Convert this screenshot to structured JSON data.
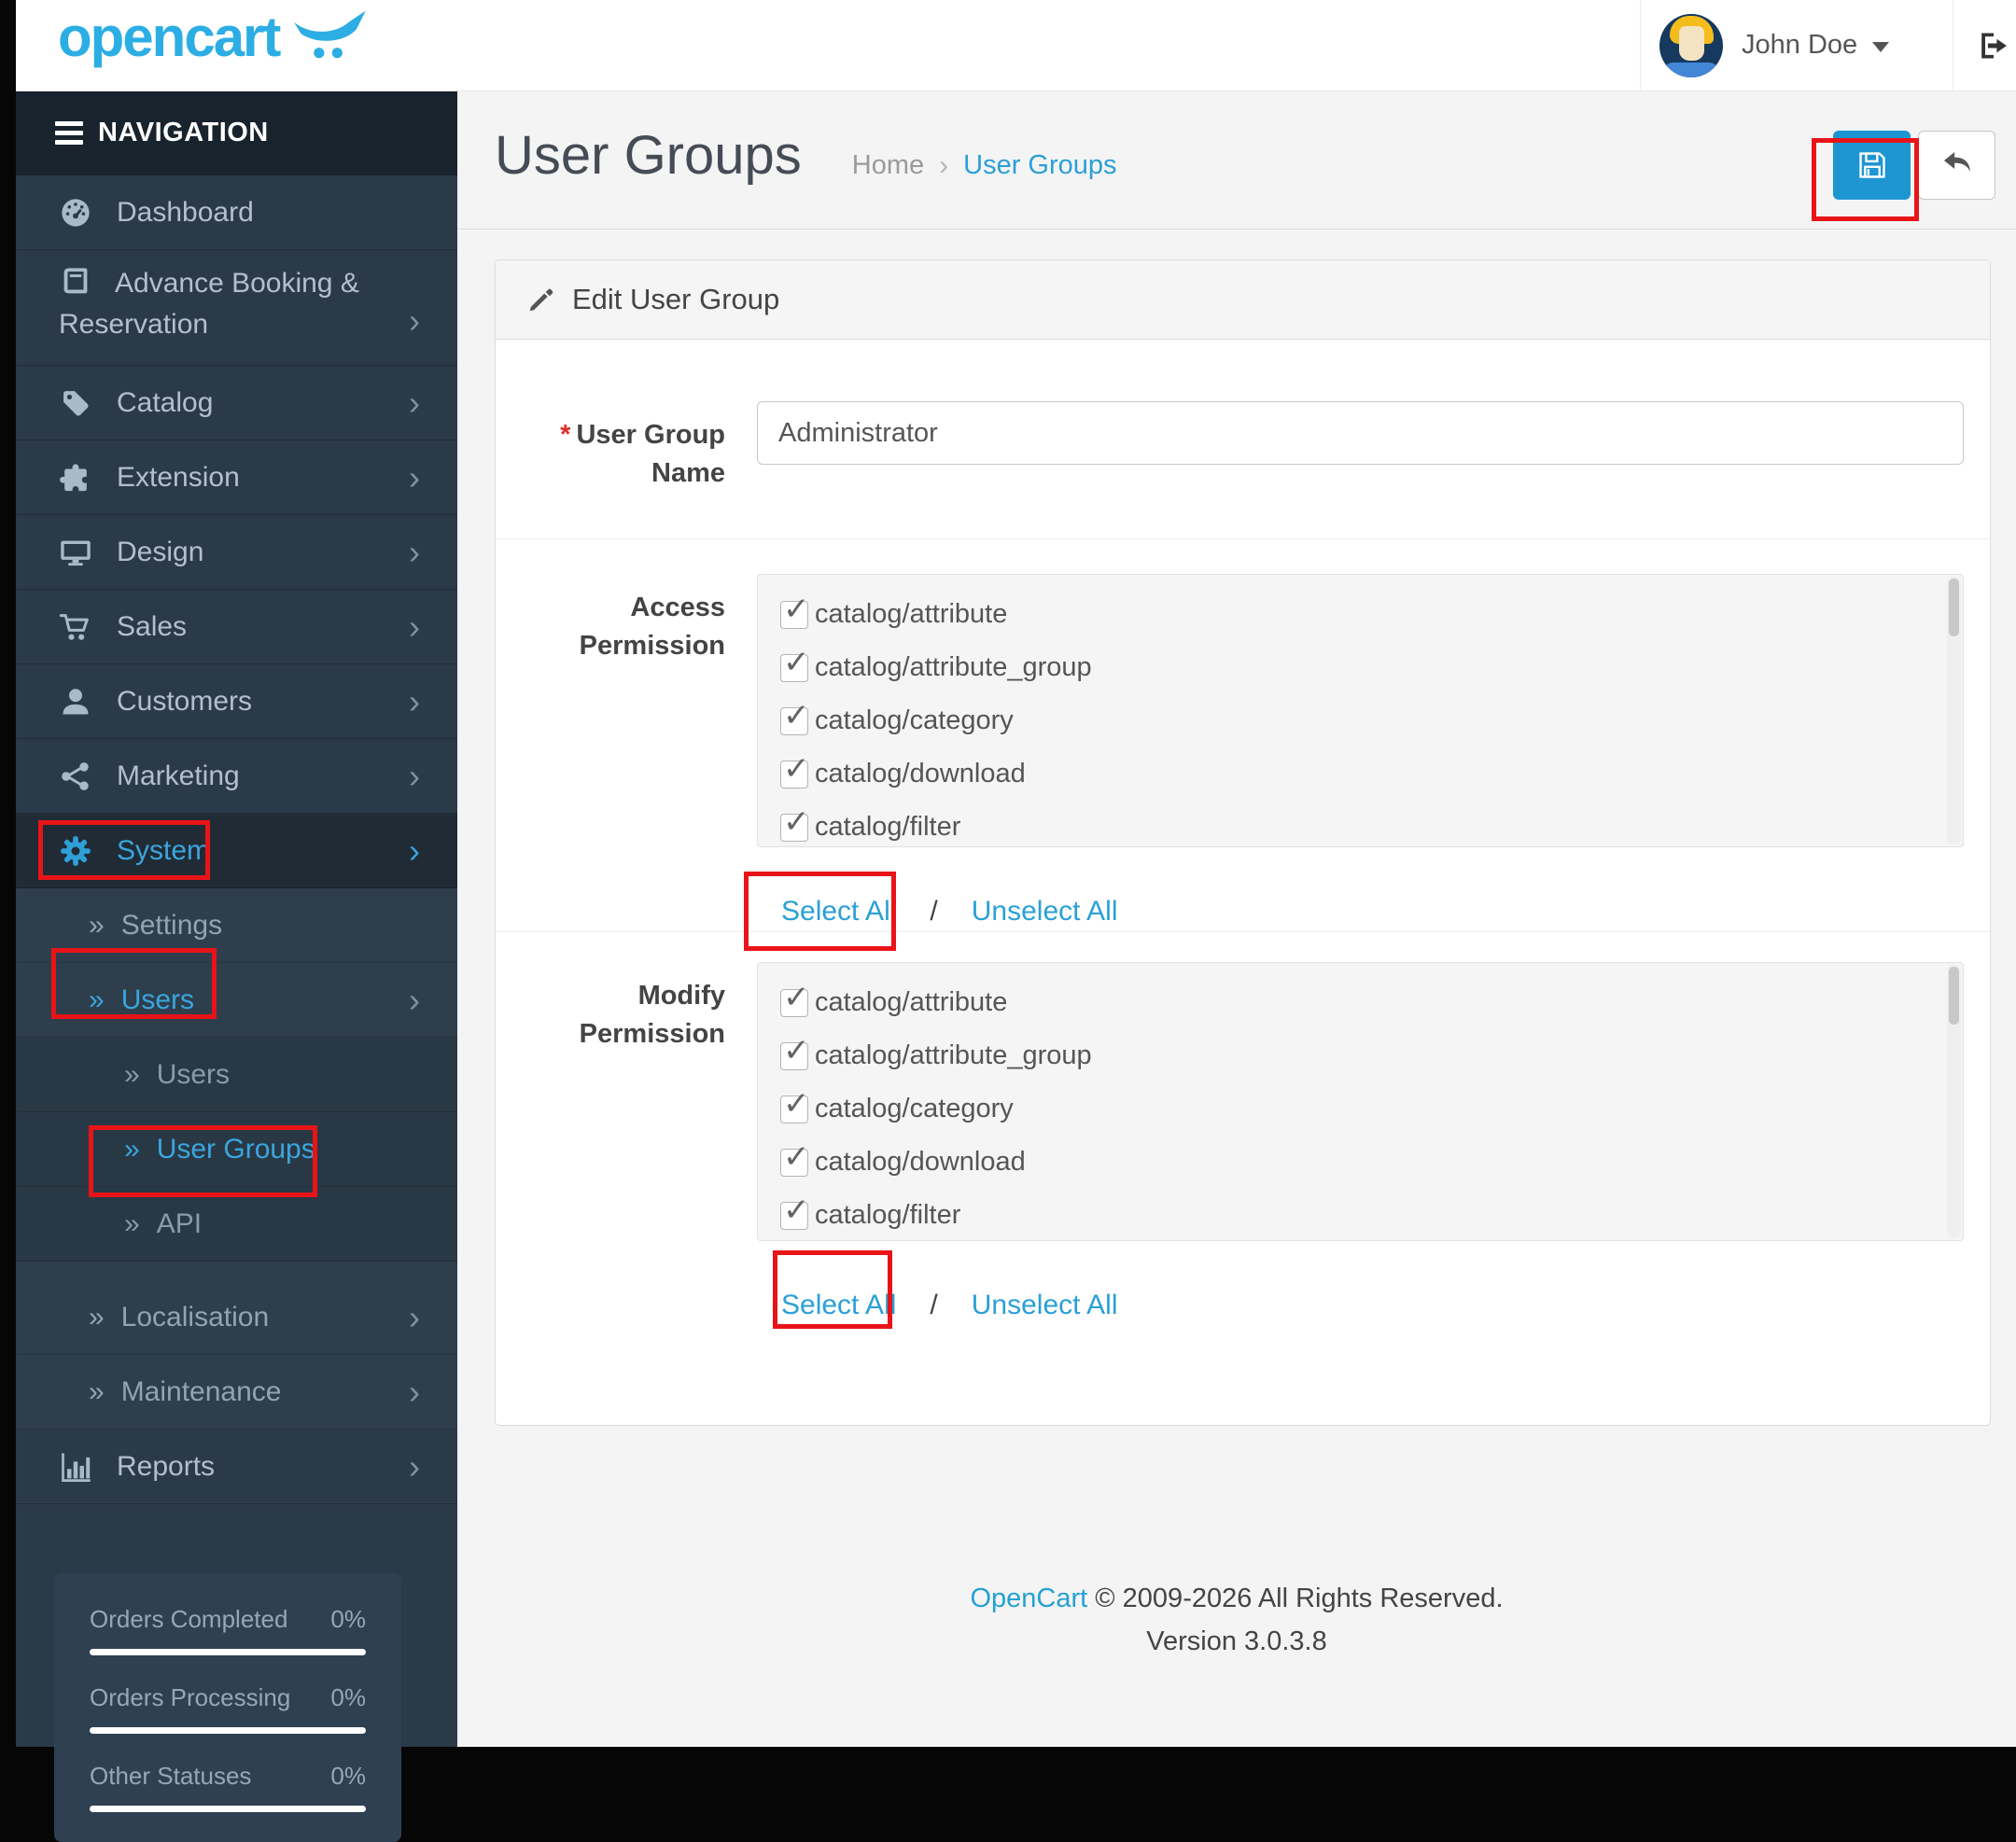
{
  "header": {
    "brand": "opencart",
    "user_name": "John Doe"
  },
  "sidebar": {
    "nav_title": "NAVIGATION",
    "items": [
      {
        "label": "Dashboard"
      },
      {
        "label": "Advance Booking & Reservation"
      },
      {
        "label": "Catalog"
      },
      {
        "label": "Extension"
      },
      {
        "label": "Design"
      },
      {
        "label": "Sales"
      },
      {
        "label": "Customers"
      },
      {
        "label": "Marketing"
      },
      {
        "label": "System"
      },
      {
        "label": "Settings"
      },
      {
        "label": "Users"
      },
      {
        "label": "Users"
      },
      {
        "label": "User Groups"
      },
      {
        "label": "API"
      },
      {
        "label": "Localisation"
      },
      {
        "label": "Maintenance"
      },
      {
        "label": "Reports"
      }
    ],
    "stats": [
      {
        "label": "Orders Completed",
        "value": "0%"
      },
      {
        "label": "Orders Processing",
        "value": "0%"
      },
      {
        "label": "Other Statuses",
        "value": "0%"
      }
    ]
  },
  "page": {
    "title": "User Groups",
    "breadcrumb": {
      "home": "Home",
      "current": "User Groups"
    }
  },
  "panel": {
    "heading": "Edit User Group"
  },
  "form": {
    "required_mark": "*",
    "name_label": "User Group Name",
    "name_value": "Administrator",
    "access": {
      "label": "Access Permission",
      "items": [
        "catalog/attribute",
        "catalog/attribute_group",
        "catalog/category",
        "catalog/download",
        "catalog/filter"
      ],
      "select_all": "Select All",
      "separator": "/",
      "unselect_all": "Unselect All"
    },
    "modify": {
      "label": "Modify Permission",
      "items": [
        "catalog/attribute",
        "catalog/attribute_group",
        "catalog/category",
        "catalog/download",
        "catalog/filter"
      ],
      "select_all": "Select All",
      "separator": "/",
      "unselect_all": "Unselect All"
    }
  },
  "footer": {
    "link": "OpenCart",
    "text": "© 2009-2026 All Rights Reserved.",
    "version": "Version 3.0.3.8"
  },
  "colors": {
    "accent_blue": "#1e96d2",
    "link_blue": "#2aa0d6",
    "sidebar_bg": "#2b3a49",
    "annotation_red": "#e81417"
  }
}
